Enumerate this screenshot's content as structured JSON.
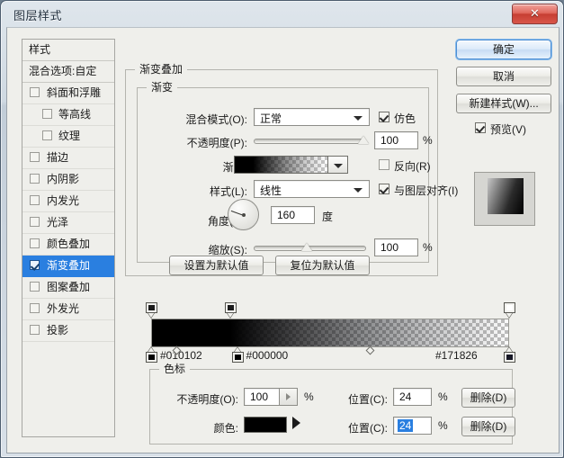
{
  "window": {
    "title": "图层样式",
    "close_label": "✕"
  },
  "styles_panel": {
    "header": "样式",
    "blending_options": "混合选项:自定",
    "items": [
      {
        "label": "斜面和浮雕",
        "checked": false,
        "indent": false,
        "selected": false
      },
      {
        "label": "等高线",
        "checked": false,
        "indent": true,
        "selected": false
      },
      {
        "label": "纹理",
        "checked": false,
        "indent": true,
        "selected": false
      },
      {
        "label": "描边",
        "checked": false,
        "indent": false,
        "selected": false
      },
      {
        "label": "内阴影",
        "checked": false,
        "indent": false,
        "selected": false
      },
      {
        "label": "内发光",
        "checked": false,
        "indent": false,
        "selected": false
      },
      {
        "label": "光泽",
        "checked": false,
        "indent": false,
        "selected": false
      },
      {
        "label": "颜色叠加",
        "checked": false,
        "indent": false,
        "selected": false
      },
      {
        "label": "渐变叠加",
        "checked": true,
        "indent": false,
        "selected": true
      },
      {
        "label": "图案叠加",
        "checked": false,
        "indent": false,
        "selected": false
      },
      {
        "label": "外发光",
        "checked": false,
        "indent": false,
        "selected": false
      },
      {
        "label": "投影",
        "checked": false,
        "indent": false,
        "selected": false
      }
    ]
  },
  "overlay_group": {
    "caption": "渐变叠加",
    "gradient_group": {
      "caption": "渐变",
      "blend_mode": {
        "label": "混合模式(O):",
        "value": "正常"
      },
      "dither": {
        "label": "仿色",
        "checked": true
      },
      "opacity": {
        "label": "不透明度(P):",
        "value": "100",
        "unit": "%"
      },
      "gradient": {
        "label": "渐变:"
      },
      "reverse": {
        "label": "反向(R)",
        "checked": false
      },
      "style": {
        "label": "样式(L):",
        "value": "线性"
      },
      "align_with_layer": {
        "label": "与图层对齐(I)",
        "checked": true
      },
      "angle": {
        "label": "角度(N):",
        "value": "160",
        "unit": "度"
      },
      "scale": {
        "label": "缩放(S):",
        "value": "100",
        "unit": "%"
      }
    },
    "set_default_button": "设置为默认值",
    "reset_default_button": "复位为默认值"
  },
  "right_buttons": {
    "ok": "确定",
    "cancel": "取消",
    "new_style": "新建样式(W)...",
    "preview": {
      "label": "预览(V)",
      "checked": true
    }
  },
  "gradient_editor": {
    "opacity_stops": [
      {
        "position_pct": 0,
        "color": "#1b1b1b"
      },
      {
        "position_pct": 22,
        "color": "#1b1b1b"
      },
      {
        "position_pct": 100,
        "color": "#ffffff"
      }
    ],
    "color_stops": [
      {
        "position_pct": 0,
        "hex": "#010102",
        "swatch": "#010102"
      },
      {
        "position_pct": 24,
        "hex": "#000000",
        "swatch": "#000000"
      },
      {
        "position_pct": 100,
        "hex": "#171826",
        "swatch": "#171826"
      }
    ],
    "midpoints": [
      {
        "position_pct": 7
      },
      {
        "position_pct": 61
      }
    ]
  },
  "stop_group": {
    "caption": "色标",
    "opacity": {
      "label": "不透明度(O):",
      "value": "100",
      "unit": "%"
    },
    "opacity_position": {
      "label": "位置(C):",
      "value": "24",
      "unit": "%"
    },
    "color": {
      "label": "颜色:",
      "value": "#000000"
    },
    "color_position": {
      "label": "位置(C):",
      "value": "24",
      "unit": "%"
    },
    "delete_opacity_button": "删除(D)",
    "delete_color_button": "删除(D)"
  }
}
